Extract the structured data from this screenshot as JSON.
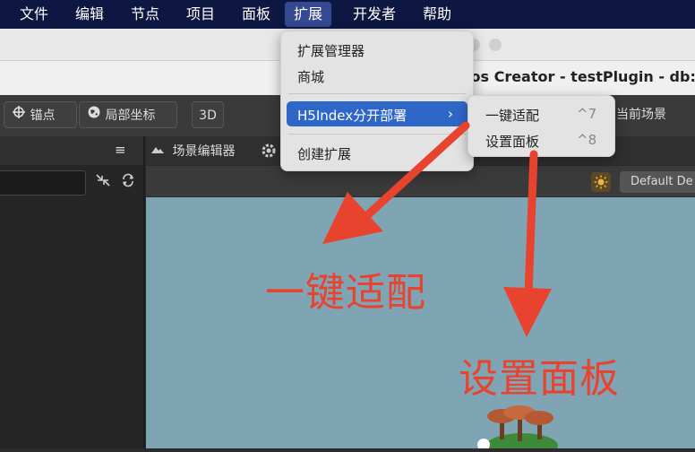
{
  "menubar": {
    "items": [
      "文件",
      "编辑",
      "节点",
      "项目",
      "面板",
      "扩展",
      "开发者",
      "帮助"
    ],
    "active": "扩展"
  },
  "window": {
    "title": "cos Creator - testPlugin - db:"
  },
  "toolbar": {
    "anchor_label": "锚点",
    "local_coords_label": "局部坐标",
    "mode_3d_label": "3D",
    "current_scene_label": "当前场景"
  },
  "scene_editor": {
    "tab_label": "场景编辑器",
    "camera_dropdown": "Default De"
  },
  "extension_menu": {
    "items": [
      "扩展管理器",
      "商城",
      "H5Index分开部署",
      "创建扩展"
    ],
    "highlighted": "H5Index分开部署"
  },
  "submenu": {
    "items": [
      {
        "label": "一键适配",
        "shortcut": "^7"
      },
      {
        "label": "设置面板",
        "shortcut": "^8"
      }
    ]
  },
  "annotations": {
    "left_text": "一键适配",
    "right_text": "设置面板",
    "color": "#e8432e"
  },
  "colors": {
    "menubar_bg": "#0e1742",
    "highlight": "#2f67c9",
    "scene_bg": "#7fa5b5"
  }
}
